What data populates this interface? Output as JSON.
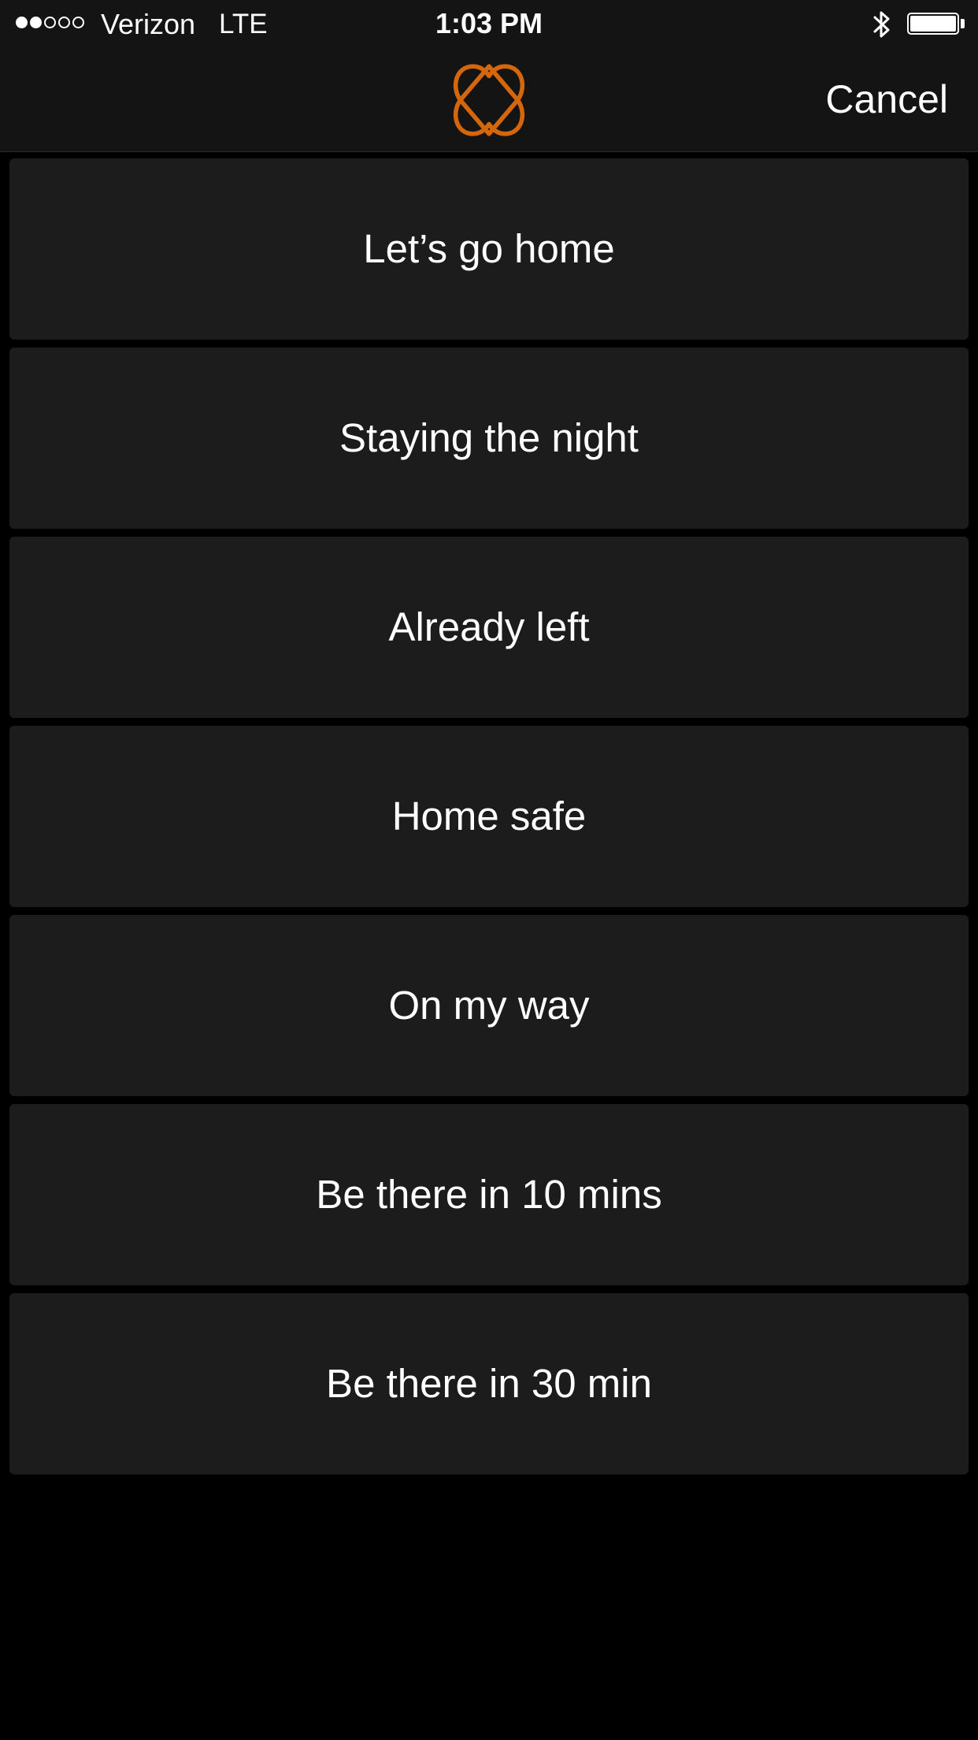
{
  "status_bar": {
    "carrier": "Verizon",
    "network": "LTE",
    "time": "1:03 PM",
    "signal_bars_filled": 2,
    "signal_bars_total": 5,
    "battery_level": 1.0,
    "bluetooth_icon": "bluetooth-icon"
  },
  "nav": {
    "logo_icon": "interlocking-hearts-logo",
    "cancel_label": "Cancel"
  },
  "options": [
    {
      "label": "Let’s go home"
    },
    {
      "label": "Staying the night"
    },
    {
      "label": "Already left"
    },
    {
      "label": "Home safe"
    },
    {
      "label": "On my way"
    },
    {
      "label": "Be there in 10 mins"
    },
    {
      "label": "Be there in 30 min"
    }
  ],
  "colors": {
    "accent": "#D4660C",
    "background": "#000000",
    "bar_background": "#141414",
    "option_background": "#1C1C1C",
    "text": "#FFFFFF"
  }
}
